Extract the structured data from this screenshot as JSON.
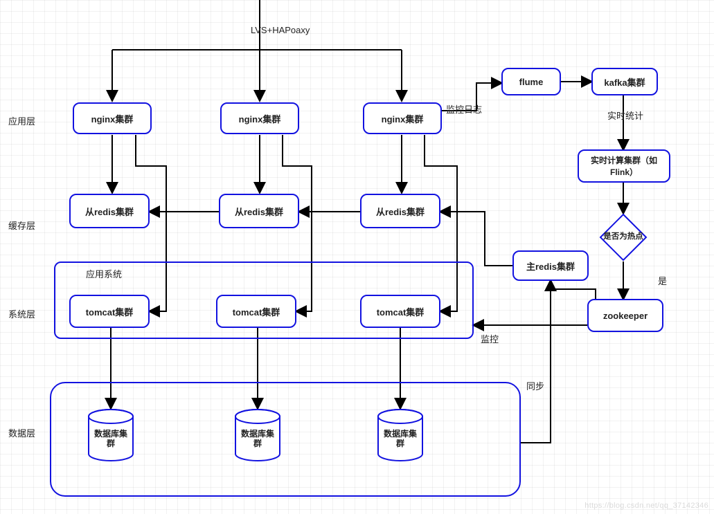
{
  "diagram": {
    "top_label": "LVS+HAPoaxy",
    "layers": {
      "application": "应用层",
      "cache": "缓存层",
      "system": "系统层",
      "data": "数据层"
    },
    "nodes": {
      "nginx1": "nginx集群",
      "nginx2": "nginx集群",
      "nginx3": "nginx集群",
      "redis_slave1": "从redis集群",
      "redis_slave2": "从redis集群",
      "redis_slave3": "从redis集群",
      "app_system_title": "应用系统",
      "tomcat1": "tomcat集群",
      "tomcat2": "tomcat集群",
      "tomcat3": "tomcat集群",
      "db1_line1": "数据库集",
      "db1_line2": "群",
      "db2_line1": "数据库集",
      "db2_line2": "群",
      "db3_line1": "数据库集",
      "db3_line2": "群",
      "flume": "flume",
      "kafka": "kafka集群",
      "realtime_compute": "实时计算集群（如Flink）",
      "hotspot_decision": "是否为热点",
      "zookeeper": "zookeeper",
      "master_redis": "主redis集群"
    },
    "edge_labels": {
      "monitor_log": "监控日志",
      "realtime_stats": "实时统计",
      "is_hotspot_yes": "是",
      "monitor": "监控",
      "sync": "同步"
    },
    "watermark": "https://blog.csdn.net/qq_37142346"
  }
}
